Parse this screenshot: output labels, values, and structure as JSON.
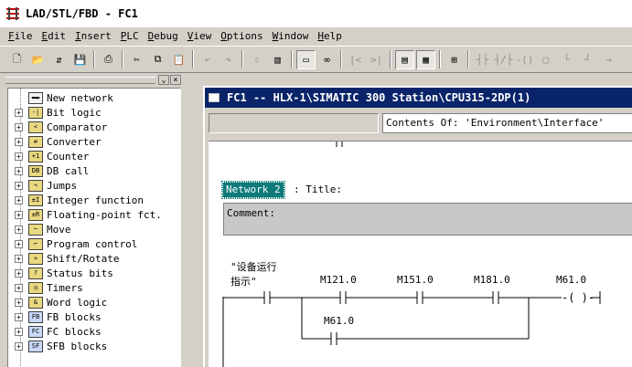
{
  "window": {
    "title": "LAD/STL/FBD  - FC1"
  },
  "menu": [
    {
      "key": "F",
      "rest": "ile"
    },
    {
      "key": "E",
      "rest": "dit"
    },
    {
      "key": "I",
      "rest": "nsert"
    },
    {
      "key": "P",
      "rest": "LC"
    },
    {
      "key": "D",
      "rest": "ebug"
    },
    {
      "key": "V",
      "rest": "iew"
    },
    {
      "key": "O",
      "rest": "ptions"
    },
    {
      "key": "W",
      "rest": "indow"
    },
    {
      "key": "H",
      "rest": "elp"
    }
  ],
  "catalog": {
    "items": [
      {
        "label": "New network",
        "expandable": false,
        "icon": "new-network-icon",
        "glyph": "▬▬"
      },
      {
        "label": "Bit logic",
        "expandable": true,
        "icon": "bit-logic-icon",
        "glyph": "-|"
      },
      {
        "label": "Comparator",
        "expandable": true,
        "icon": "comparator-icon",
        "glyph": "<"
      },
      {
        "label": "Converter",
        "expandable": true,
        "icon": "converter-icon",
        "glyph": "⇄"
      },
      {
        "label": "Counter",
        "expandable": true,
        "icon": "counter-icon",
        "glyph": "+1"
      },
      {
        "label": "DB call",
        "expandable": true,
        "icon": "db-call-icon",
        "glyph": "DB"
      },
      {
        "label": "Jumps",
        "expandable": true,
        "icon": "jumps-icon",
        "glyph": "↷"
      },
      {
        "label": "Integer function",
        "expandable": true,
        "icon": "integer-function-icon",
        "glyph": "±I"
      },
      {
        "label": "Floating-point fct.",
        "expandable": true,
        "icon": "floating-point-icon",
        "glyph": "±R"
      },
      {
        "label": "Move",
        "expandable": true,
        "icon": "move-icon",
        "glyph": "~"
      },
      {
        "label": "Program control",
        "expandable": true,
        "icon": "program-control-icon",
        "glyph": "⌐"
      },
      {
        "label": "Shift/Rotate",
        "expandable": true,
        "icon": "shift-rotate-icon",
        "glyph": "»"
      },
      {
        "label": "Status bits",
        "expandable": true,
        "icon": "status-bits-icon",
        "glyph": "?"
      },
      {
        "label": "Timers",
        "expandable": true,
        "icon": "timers-icon",
        "glyph": "◷"
      },
      {
        "label": "Word logic",
        "expandable": true,
        "icon": "word-logic-icon",
        "glyph": "&"
      },
      {
        "label": "FB blocks",
        "expandable": true,
        "icon": "fb-blocks-icon",
        "glyph": "FB"
      },
      {
        "label": "FC blocks",
        "expandable": true,
        "icon": "fc-blocks-icon",
        "glyph": "FC"
      },
      {
        "label": "SFB blocks",
        "expandable": true,
        "icon": "sfb-blocks-icon",
        "glyph": "SF"
      }
    ]
  },
  "editor": {
    "title": "FC1 -- HLX-1\\SIMATIC 300 Station\\CPU315-2DP(1)",
    "interface_path": "Contents Of: 'Environment\\Interface'",
    "network": {
      "badge": "Network 2",
      "title_label": ": Title:",
      "comment_label": "Comment:",
      "symbol_line1": "\"设备运行",
      "symbol_line2": "指示\"",
      "contacts": [
        "M121.0",
        "M151.0",
        "M181.0"
      ],
      "coil": "M61.0",
      "parallel_contact": "M61.0"
    }
  }
}
